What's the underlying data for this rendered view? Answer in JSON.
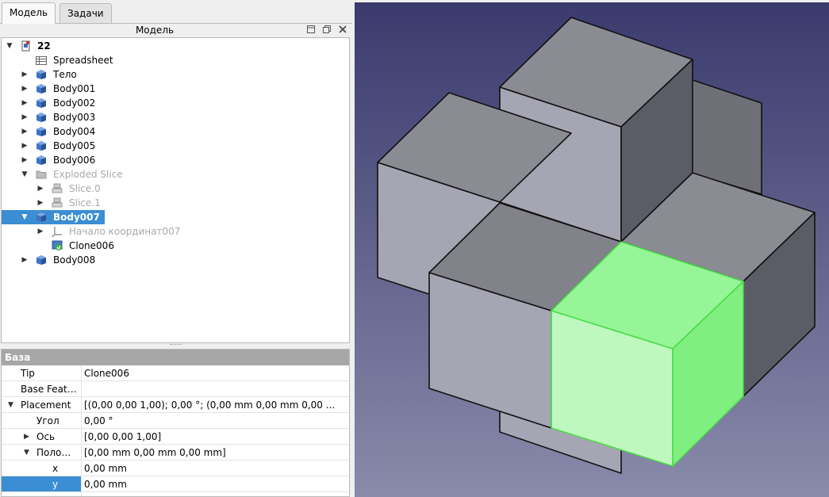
{
  "tabs": {
    "model": "Модель",
    "tasks": "Задачи"
  },
  "tree_panel": {
    "title": "Модель"
  },
  "tree": {
    "root": "22",
    "items": [
      {
        "label": "Spreadsheet"
      },
      {
        "label": "Тело"
      },
      {
        "label": "Body001"
      },
      {
        "label": "Body002"
      },
      {
        "label": "Body003"
      },
      {
        "label": "Body004"
      },
      {
        "label": "Body005"
      },
      {
        "label": "Body006"
      },
      {
        "label": "Exploded Slice"
      },
      {
        "label": "Slice.0"
      },
      {
        "label": "Slice.1"
      },
      {
        "label": "Body007"
      },
      {
        "label": "Начало координат007"
      },
      {
        "label": "Clone006"
      },
      {
        "label": "Body008"
      }
    ]
  },
  "properties": {
    "group": "База",
    "rows": [
      {
        "name": "Tip",
        "value": "Clone006"
      },
      {
        "name": "Base Feat…",
        "value": ""
      },
      {
        "name": "Placement",
        "value": "[(0,00 0,00 1,00); 0,00 °; (0,00 mm  0,00 mm  0,00 ..."
      },
      {
        "name": "Угол",
        "value": "0,00 °"
      },
      {
        "name": "Ось",
        "value": "[0,00 0,00 1,00]"
      },
      {
        "name": "Поло…",
        "value": "[0,00 mm  0,00 mm  0,00 mm]"
      },
      {
        "name": "x",
        "value": "0,00 mm"
      },
      {
        "name": "y",
        "value": "0,00 mm"
      }
    ]
  },
  "colors": {
    "selection": "#3b8ed3",
    "viewport_top": "#3a3a6e",
    "viewport_bottom": "#8a8aab",
    "highlight_green": "#6af06a"
  }
}
